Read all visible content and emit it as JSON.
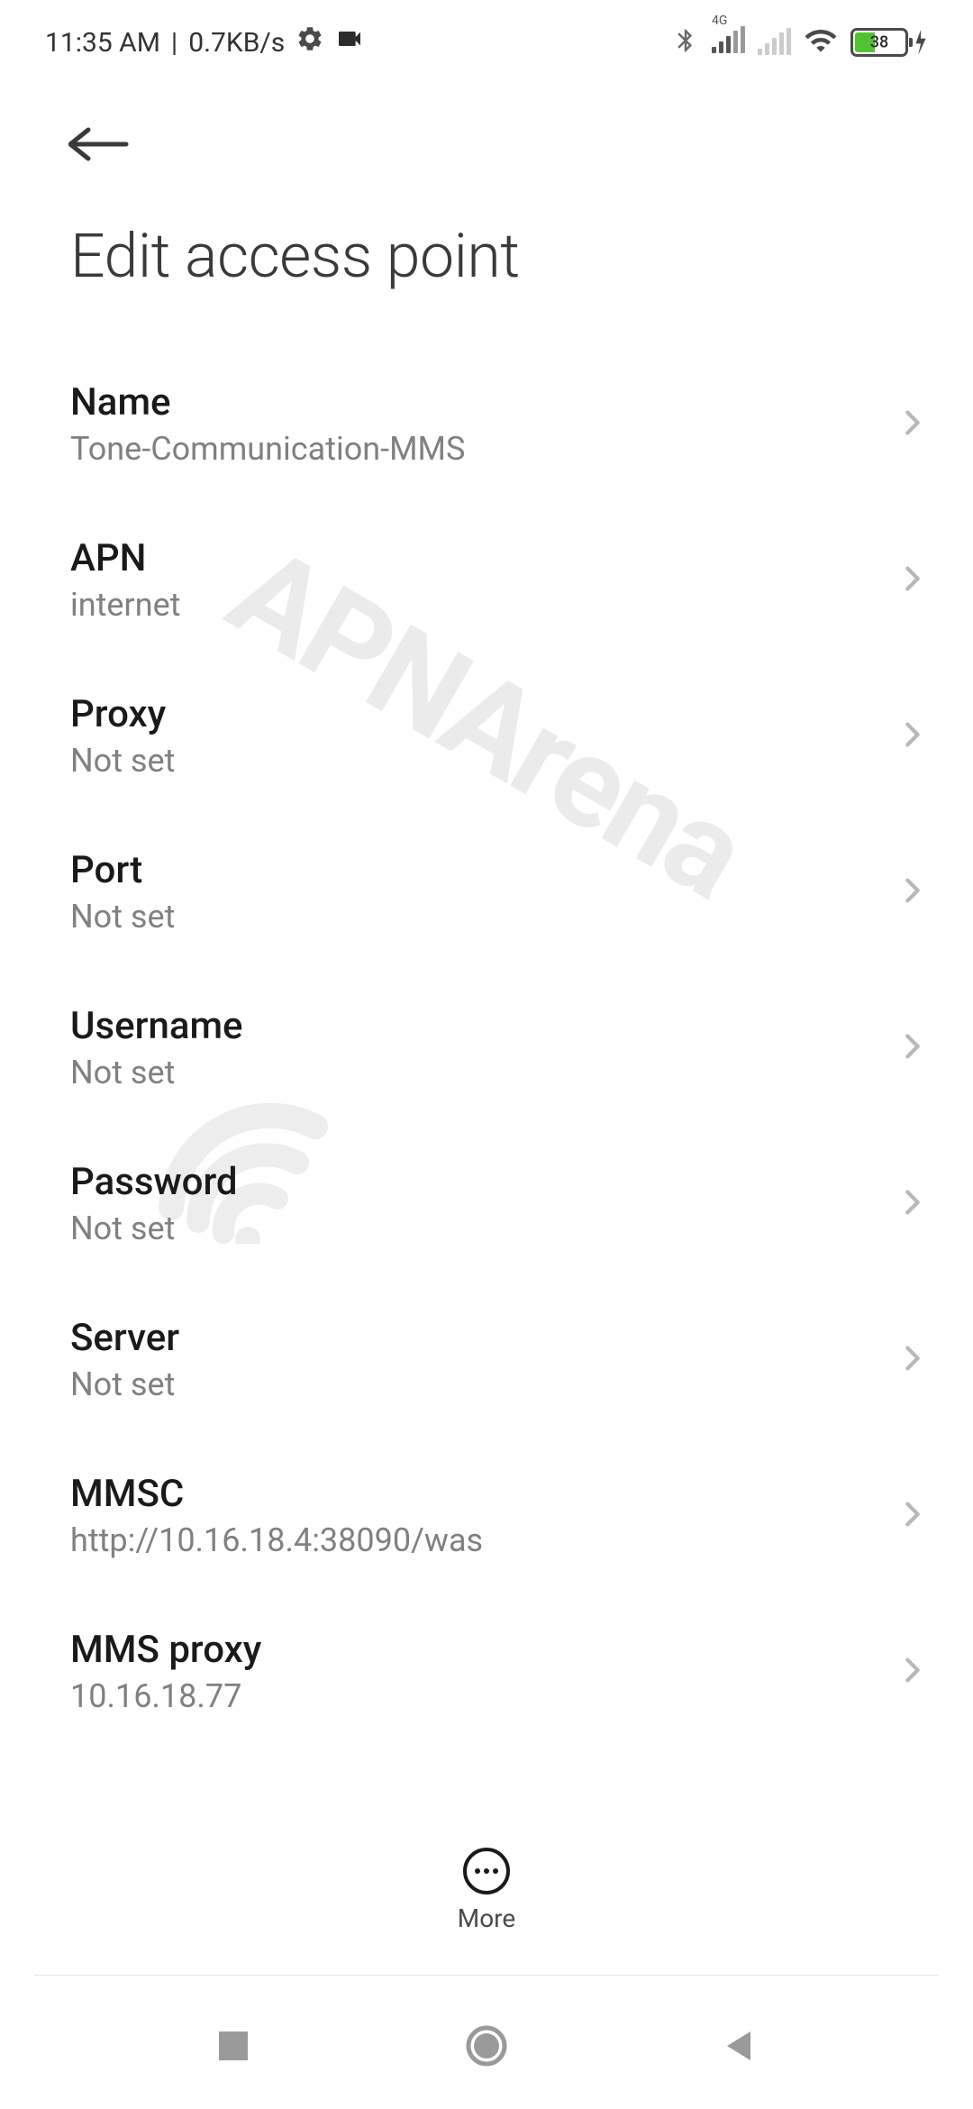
{
  "status_bar": {
    "time": "11:35 AM",
    "data_rate": "0.7KB/s",
    "net_label": "4G",
    "battery_percent": "38"
  },
  "header": {
    "title": "Edit access point"
  },
  "settings": [
    {
      "label": "Name",
      "value": "Tone-Communication-MMS"
    },
    {
      "label": "APN",
      "value": "internet"
    },
    {
      "label": "Proxy",
      "value": "Not set"
    },
    {
      "label": "Port",
      "value": "Not set"
    },
    {
      "label": "Username",
      "value": "Not set"
    },
    {
      "label": "Password",
      "value": "Not set"
    },
    {
      "label": "Server",
      "value": "Not set"
    },
    {
      "label": "MMSC",
      "value": "http://10.16.18.4:38090/was"
    },
    {
      "label": "MMS proxy",
      "value": "10.16.18.77"
    }
  ],
  "bottom_action": {
    "more_label": "More"
  },
  "watermark": "APNArena"
}
